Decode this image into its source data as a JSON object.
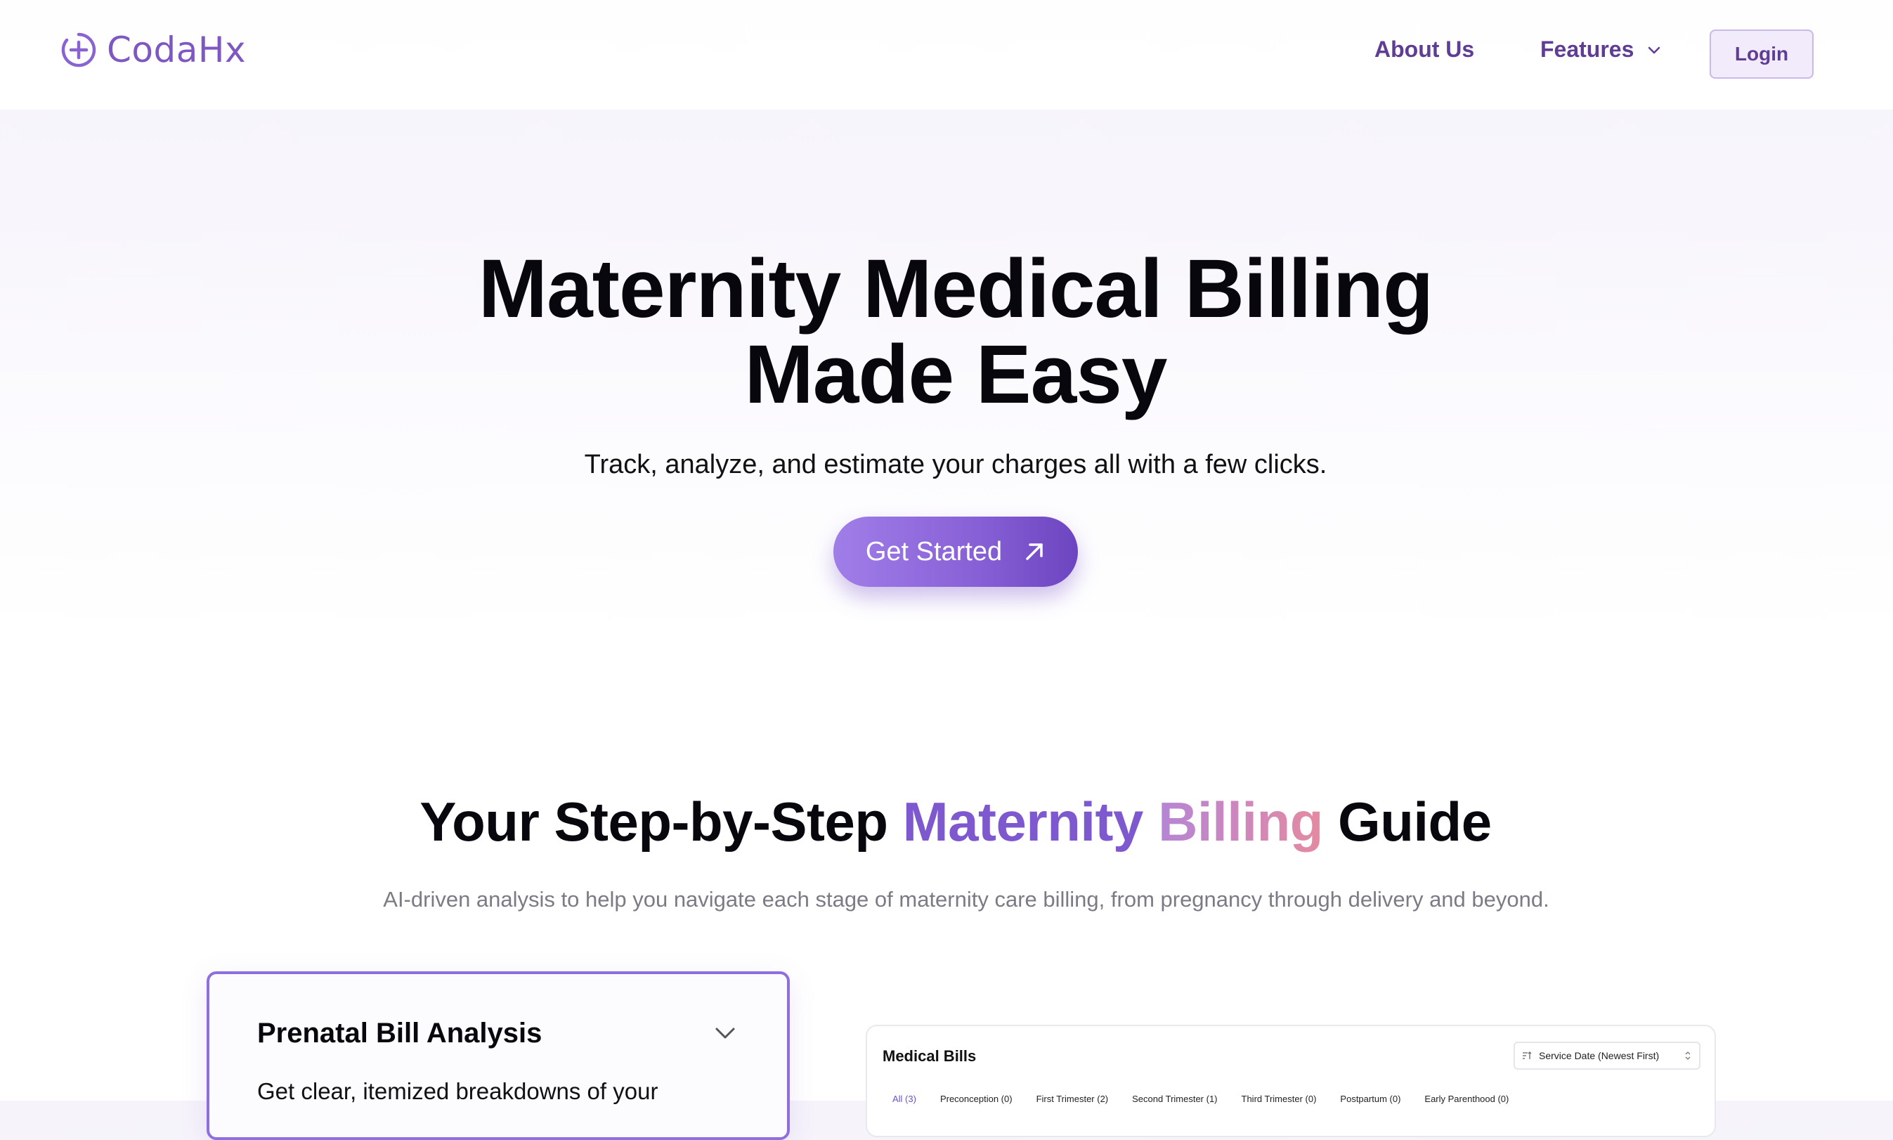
{
  "nav": {
    "logo_text": "CodaHx",
    "about_label": "About Us",
    "features_label": "Features",
    "login_label": "Login"
  },
  "hero": {
    "title_line1": "Maternity Medical Billing",
    "title_line2": "Made Easy",
    "subtitle": "Track, analyze, and estimate your charges all with a few clicks.",
    "cta_label": "Get Started"
  },
  "guide": {
    "title_part1": "Your Step-by-Step ",
    "title_highlight1": "Maternity",
    "title_space": " ",
    "title_highlight2": "Billing",
    "title_part2": " Guide",
    "subtitle": "AI-driven analysis to help you navigate each stage of maternity care billing, from pregnancy through delivery and beyond."
  },
  "feature_card": {
    "title": "Prenatal Bill Analysis",
    "body": "Get clear, itemized breakdowns of your"
  },
  "preview": {
    "title": "Medical Bills",
    "sort_label": "Service Date (Newest First)",
    "tabs": [
      "All (3)",
      "Preconception (0)",
      "First Trimester (2)",
      "Second Trimester (1)",
      "Third Trimester (0)",
      "Postpartum (0)",
      "Early Parenthood (0)"
    ]
  },
  "colors": {
    "brand": "#7e57c2",
    "nav_text": "#5f3d95",
    "cta_gradient_start": "#a07ee8",
    "cta_gradient_end": "#6c45c0",
    "highlight_purple": "#7d58cf",
    "highlight_pink": "#e58aa0"
  },
  "icons": {
    "logo": "plus-circle-icon",
    "features": "chevron-down-icon",
    "cta": "arrow-up-right-icon",
    "card": "chevron-down-icon",
    "sort": "sort-icon",
    "select": "updown-chevron-icon"
  }
}
